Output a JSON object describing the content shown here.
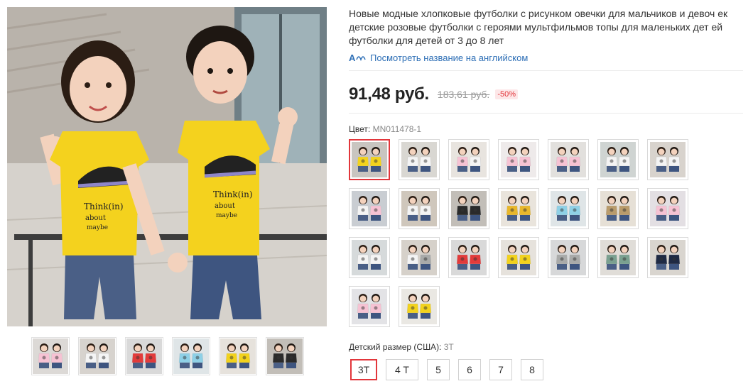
{
  "product": {
    "title": "Новые модные хлопковые футболки с рисунком овечки для мальчиков и девоч ек детские розовые футболки с героями мультфильмов топы для маленьких дет ей футболки для детей от 3 до 8 лет",
    "translate_link": "Посмотреть название на английском",
    "price": "91,48 руб.",
    "old_price": "183,61 руб.",
    "discount": "-50%"
  },
  "color": {
    "label": "Цвет:",
    "selected_value": "MN011478-1",
    "swatches": [
      {
        "shirt": "#f2d21c",
        "shirt2": "#f2d21c",
        "bg": "#c9c5c0"
      },
      {
        "shirt": "#f4f4f4",
        "shirt2": "#f4f4f4",
        "bg": "#d9d7d2"
      },
      {
        "shirt": "#f6c2d3",
        "shirt2": "#f4f4f4",
        "bg": "#e8e4df"
      },
      {
        "shirt": "#f6c2d3",
        "shirt2": "#f6c2d3",
        "bg": "#eeeaea"
      },
      {
        "shirt": "#f6c2d3",
        "shirt2": "#f6c2d3",
        "bg": "#e2e0dd"
      },
      {
        "shirt": "#f4f4f4",
        "shirt2": "#f4f4f4",
        "bg": "#cfd4d2"
      },
      {
        "shirt": "#f4f4f4",
        "shirt2": "#f4f4f4",
        "bg": "#d8d3cd"
      },
      {
        "shirt": "#f4f4f4",
        "shirt2": "#f6c2d3",
        "bg": "#c9cdd2"
      },
      {
        "shirt": "#f4f4f4",
        "shirt2": "#f4f4f4",
        "bg": "#cfc7bc"
      },
      {
        "shirt": "#2a2a2a",
        "shirt2": "#2a2a2a",
        "bg": "#c2beb8"
      },
      {
        "shirt": "#e8b72b",
        "shirt2": "#e8b72b",
        "bg": "#e9e4dc"
      },
      {
        "shirt": "#8ed0e6",
        "shirt2": "#8ed0e6",
        "bg": "#dfe5e7"
      },
      {
        "shirt": "#b99b6b",
        "shirt2": "#b99b6b",
        "bg": "#e6e0d6"
      },
      {
        "shirt": "#f6c2d3",
        "shirt2": "#f6c2d3",
        "bg": "#e3dfe3"
      },
      {
        "shirt": "#f4f4f4",
        "shirt2": "#f4f4f4",
        "bg": "#d6dadb"
      },
      {
        "shirt": "#f4f4f4",
        "shirt2": "#a9aaa9",
        "bg": "#d6d1ca"
      },
      {
        "shirt": "#e23b3b",
        "shirt2": "#e23b3b",
        "bg": "#d9d9d9"
      },
      {
        "shirt": "#f2d21c",
        "shirt2": "#f2d21c",
        "bg": "#e6e2dc"
      },
      {
        "shirt": "#a9aaa9",
        "shirt2": "#a9aaa9",
        "bg": "#d7d8d9"
      },
      {
        "shirt": "#7aa090",
        "shirt2": "#7aa090",
        "bg": "#e0ddd8"
      },
      {
        "shirt": "#1f2a44",
        "shirt2": "#1f2a44",
        "bg": "#d9d5cf"
      },
      {
        "shirt": "#f6c2d3",
        "shirt2": "#f6c2d3",
        "bg": "#e3e3e6"
      },
      {
        "shirt": "#f2d21c",
        "shirt2": "#f2d21c",
        "bg": "#eae8e3"
      }
    ]
  },
  "size": {
    "label": "Детский размер (США):",
    "selected_value": "3T",
    "options": [
      {
        "label": "3T"
      },
      {
        "label": "4 T"
      },
      {
        "label": "5"
      },
      {
        "label": "6"
      },
      {
        "label": "7"
      },
      {
        "label": "8"
      }
    ]
  },
  "thumbnails": [
    {
      "shirt": "#f6c2d3",
      "shirt2": "#f6c2d3",
      "bg": "#dcd9d6"
    },
    {
      "shirt": "#f4f4f4",
      "shirt2": "#f4f4f4",
      "bg": "#d7d3ce"
    },
    {
      "shirt": "#e23b3b",
      "shirt2": "#e23b3b",
      "bg": "#d9d9d9"
    },
    {
      "shirt": "#8ed0e6",
      "shirt2": "#8ed0e6",
      "bg": "#dfe5e7"
    },
    {
      "shirt": "#f2d21c",
      "shirt2": "#f2d21c",
      "bg": "#e6e2dc"
    },
    {
      "shirt": "#2a2a2a",
      "shirt2": "#2a2a2a",
      "bg": "#c2beb8"
    }
  ],
  "colors": {
    "accent": "#e2363b",
    "link": "#2e6fb6",
    "main_shirt": "#f4d21e"
  }
}
